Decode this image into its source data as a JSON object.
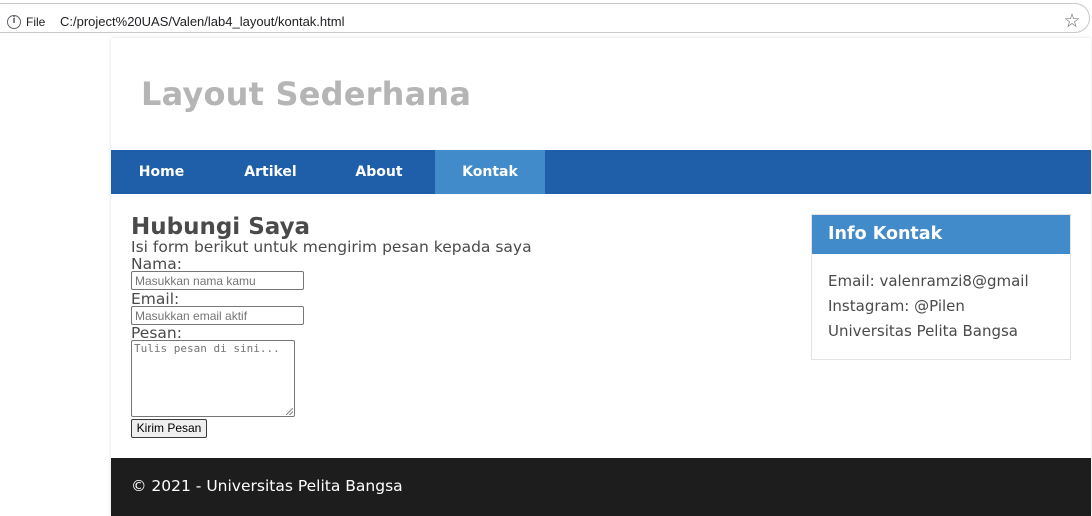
{
  "browser": {
    "file_label": "File",
    "url": "C:/project%20UAS/Valen/lab4_layout/kontak.html",
    "info_icon": "i",
    "bookmark_icon": "☆"
  },
  "header": {
    "title": "Layout Sederhana"
  },
  "nav": {
    "items": [
      {
        "label": "Home"
      },
      {
        "label": "Artikel"
      },
      {
        "label": "About"
      },
      {
        "label": "Kontak",
        "active": true
      }
    ]
  },
  "main": {
    "heading": "Hubungi Saya",
    "intro": "Isi form berikut untuk mengirim pesan kepada saya",
    "form": {
      "name_label": "Nama:",
      "name_placeholder": "Masukkan nama kamu",
      "email_label": "Email:",
      "email_placeholder": "Masukkan email aktif",
      "message_label": "Pesan:",
      "message_placeholder": "Tulis pesan di sini...",
      "submit_label": "Kirim Pesan"
    }
  },
  "sidebar": {
    "title": "Info Kontak",
    "lines": [
      "Email: valenramzi8@gmail",
      "Instagram: @Pilen",
      "Universitas Pelita Bangsa"
    ]
  },
  "footer": {
    "text": "© 2021 - Universitas Pelita Bangsa"
  },
  "colors": {
    "nav_background": "#1f5faa",
    "nav_active": "#428bca",
    "sidebar_title_background": "#428bca",
    "footer_background": "#1d1d1d",
    "site_title": "#b5b5b5"
  }
}
